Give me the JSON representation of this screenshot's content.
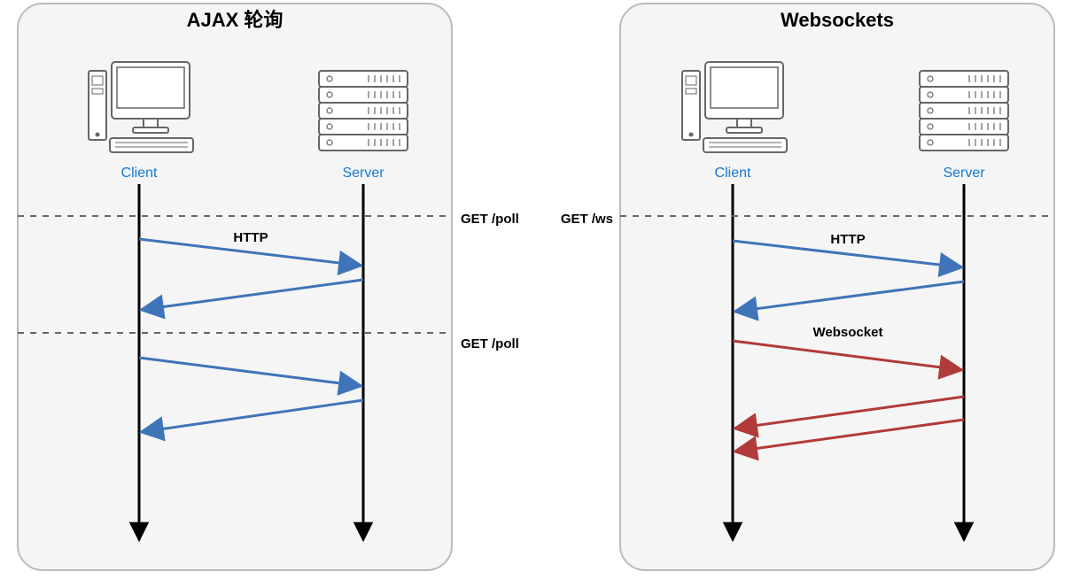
{
  "panels": {
    "left": {
      "title": "AJAX 轮询",
      "client_label": "Client",
      "server_label": "Server",
      "msg_http": "HTTP",
      "outside1": "GET /poll",
      "outside2": "GET /poll"
    },
    "right": {
      "title": "Websockets",
      "client_label": "Client",
      "server_label": "Server",
      "msg_http": "HTTP",
      "msg_ws": "Websocket",
      "outside1": "GET /ws"
    }
  },
  "icons": {
    "client": "computer-icon",
    "server": "server-rack-icon"
  },
  "colors": {
    "panel_fill": "#f5f5f5",
    "panel_stroke": "#bcbcbc",
    "lifeline": "#000000",
    "dashed": "#666666",
    "http_arrow": "#3f74b8",
    "ws_arrow": "#b13a3a",
    "actor_text": "#1477d4"
  }
}
